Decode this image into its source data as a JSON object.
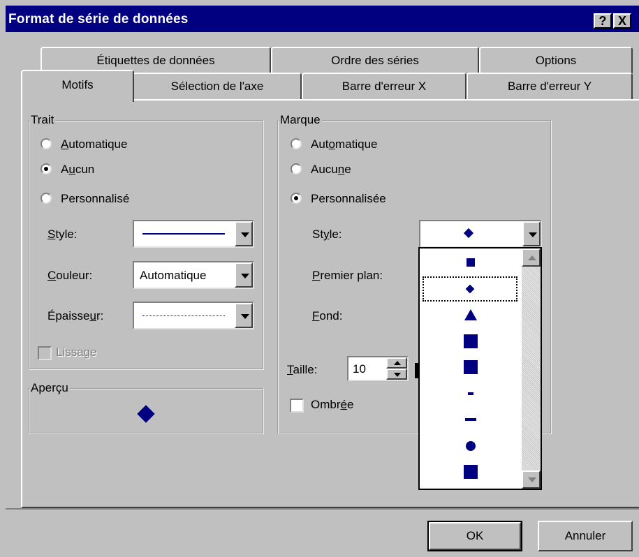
{
  "dialog": {
    "title": "Format de série de données",
    "help_label": "?",
    "close_label": "X"
  },
  "tabs": {
    "row1": [
      "Étiquettes de données",
      "Ordre des séries",
      "Options"
    ],
    "row2": [
      "Motifs",
      "Sélection de l'axe",
      "Barre d'erreur X",
      "Barre d'erreur Y"
    ],
    "active": "Motifs"
  },
  "trait": {
    "legend": "Trait",
    "options": [
      "Automatique",
      "Aucun",
      "Personnalisé"
    ],
    "selected": "Aucun",
    "style_label": "Style:",
    "color_label": "Couleur:",
    "color_value": "Automatique",
    "weight_label": "Épaisseur:",
    "smooth_label": "Lissage",
    "smooth_checked": false,
    "smooth_enabled": false
  },
  "apercu": {
    "legend": "Aperçu"
  },
  "marque": {
    "legend": "Marque",
    "options": [
      "Automatique",
      "Aucune",
      "Personnalisée"
    ],
    "selected": "Personnalisée",
    "style_label": "Style:",
    "foreground_label": "Premier plan:",
    "background_label": "Fond:",
    "size_label": "Taille:",
    "size_value": "10",
    "shadow_label": "Ombrée",
    "shadow_checked": false
  },
  "marker_styles": [
    "square",
    "diamond",
    "triangle",
    "square",
    "square",
    "short-dash",
    "dash",
    "circle",
    "square"
  ],
  "marker_selected": "diamond",
  "buttons": {
    "ok": "OK",
    "cancel": "Annuler"
  },
  "colors": {
    "title_bar": "#000080",
    "marker": "#000080",
    "dialog_bg": "#c0c0c0"
  }
}
